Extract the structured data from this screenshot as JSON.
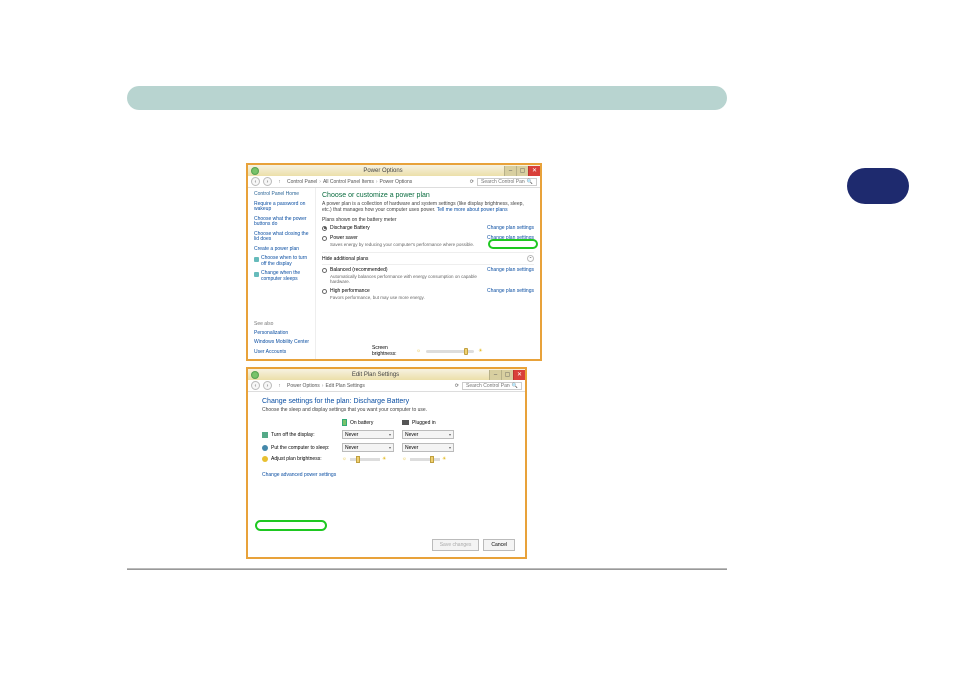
{
  "window1": {
    "title": "Power Options",
    "breadcrumb": [
      "Control Panel",
      "All Control Panel Items",
      "Power Options"
    ],
    "search_placeholder": "Search Control Panel",
    "sidebar": {
      "home": "Control Panel Home",
      "items": [
        "Require a password on wakeup",
        "Choose what the power buttons do",
        "Choose what closing the lid does",
        "Create a power plan",
        "Choose when to turn off the display",
        "Change when the computer sleeps"
      ],
      "seealso_label": "See also",
      "seealso": [
        "Personalization",
        "Windows Mobility Center",
        "User Accounts"
      ]
    },
    "heading": "Choose or customize a power plan",
    "description": "A power plan is a collection of hardware and system settings (like display brightness, sleep, etc.) that manages how your computer uses power.",
    "description_link": "Tell me more about power plans",
    "section_label": "Plans shown on the battery meter",
    "hide_label": "Hide additional plans",
    "change_link": "Change plan settings",
    "plans": [
      {
        "name": "Discharge Battery",
        "sub": "",
        "selected": true
      },
      {
        "name": "Power saver",
        "sub": "Saves energy by reducing your computer's performance where possible.",
        "selected": false
      },
      {
        "name": "Balanced (recommended)",
        "sub": "Automatically balances performance with energy consumption on capable hardware.",
        "selected": false
      },
      {
        "name": "High performance",
        "sub": "Favors performance, but may use more energy.",
        "selected": false
      }
    ],
    "brightness_label": "Screen brightness:"
  },
  "window2": {
    "title": "Edit Plan Settings",
    "breadcrumb": [
      "Power Options",
      "Edit Plan Settings"
    ],
    "search_placeholder": "Search Control Panel",
    "heading": "Change settings for the plan: Discharge Battery",
    "description": "Choose the sleep and display settings that you want your computer to use.",
    "col_battery": "On battery",
    "col_plugged": "Plugged in",
    "rows": {
      "display": "Turn off the display:",
      "sleep": "Put the computer to sleep:",
      "brightness": "Adjust plan brightness:"
    },
    "value_never": "Never",
    "advanced_link": "Change advanced power settings",
    "save_btn": "Save changes",
    "cancel_btn": "Cancel"
  }
}
